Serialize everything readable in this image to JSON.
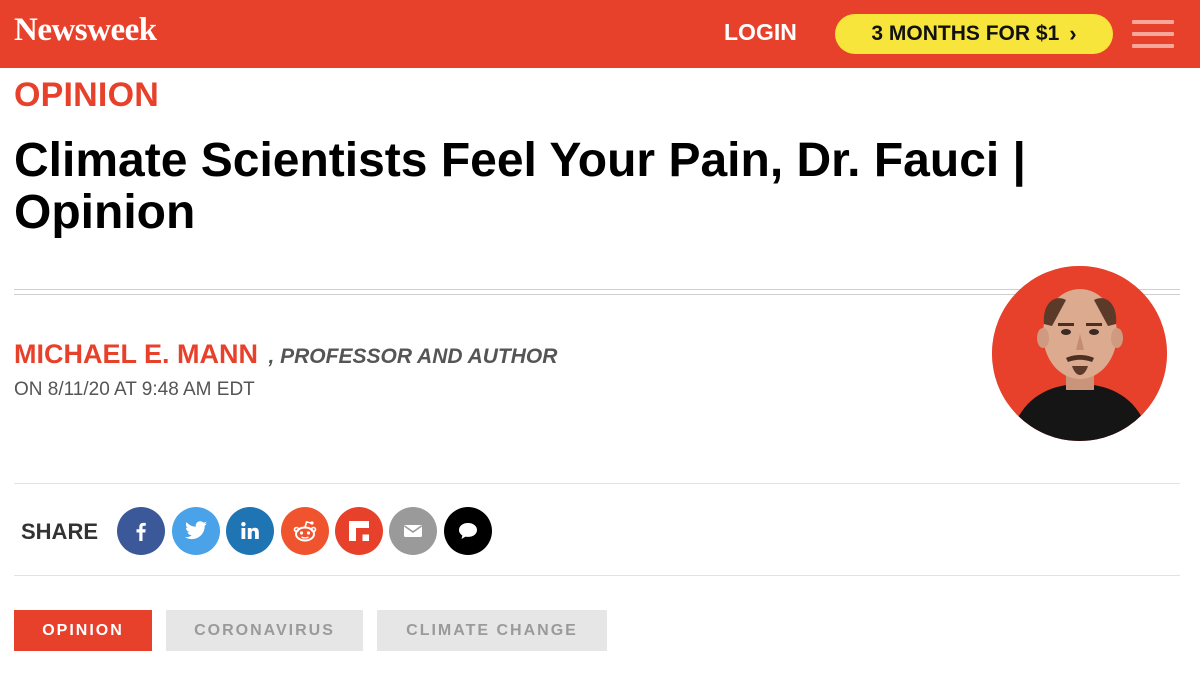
{
  "header": {
    "logo": "Newsweek",
    "login": "LOGIN",
    "promo": "3 MONTHS FOR $1",
    "promo_chevron": "›",
    "menu_icon": "hamburger-menu-icon"
  },
  "article": {
    "kicker": "OPINION",
    "headline": "Climate Scientists Feel Your Pain, Dr. Fauci | Opinion",
    "author": "MICHAEL E. MANN",
    "role": ", PROFESSOR AND AUTHOR",
    "date": "ON 8/11/20 AT 9:48 AM EDT"
  },
  "share": {
    "label": "SHARE",
    "buttons": [
      {
        "icon": "facebook-icon",
        "color": "#3b5998"
      },
      {
        "icon": "twitter-icon",
        "color": "#4aa3e8"
      },
      {
        "icon": "linkedin-icon",
        "color": "#1f75b4"
      },
      {
        "icon": "reddit-icon",
        "color": "#f0542f"
      },
      {
        "icon": "flipboard-icon",
        "color": "#e8412b"
      },
      {
        "icon": "email-icon",
        "color": "#9a9a9a"
      },
      {
        "icon": "comment-icon",
        "color": "#000000"
      }
    ]
  },
  "tags": [
    {
      "label": "OPINION",
      "active": true
    },
    {
      "label": "CORONAVIRUS",
      "active": false
    },
    {
      "label": "CLIMATE CHANGE",
      "active": false
    }
  ],
  "colors": {
    "brand_red": "#e8412b",
    "promo_yellow": "#f7e53b"
  }
}
